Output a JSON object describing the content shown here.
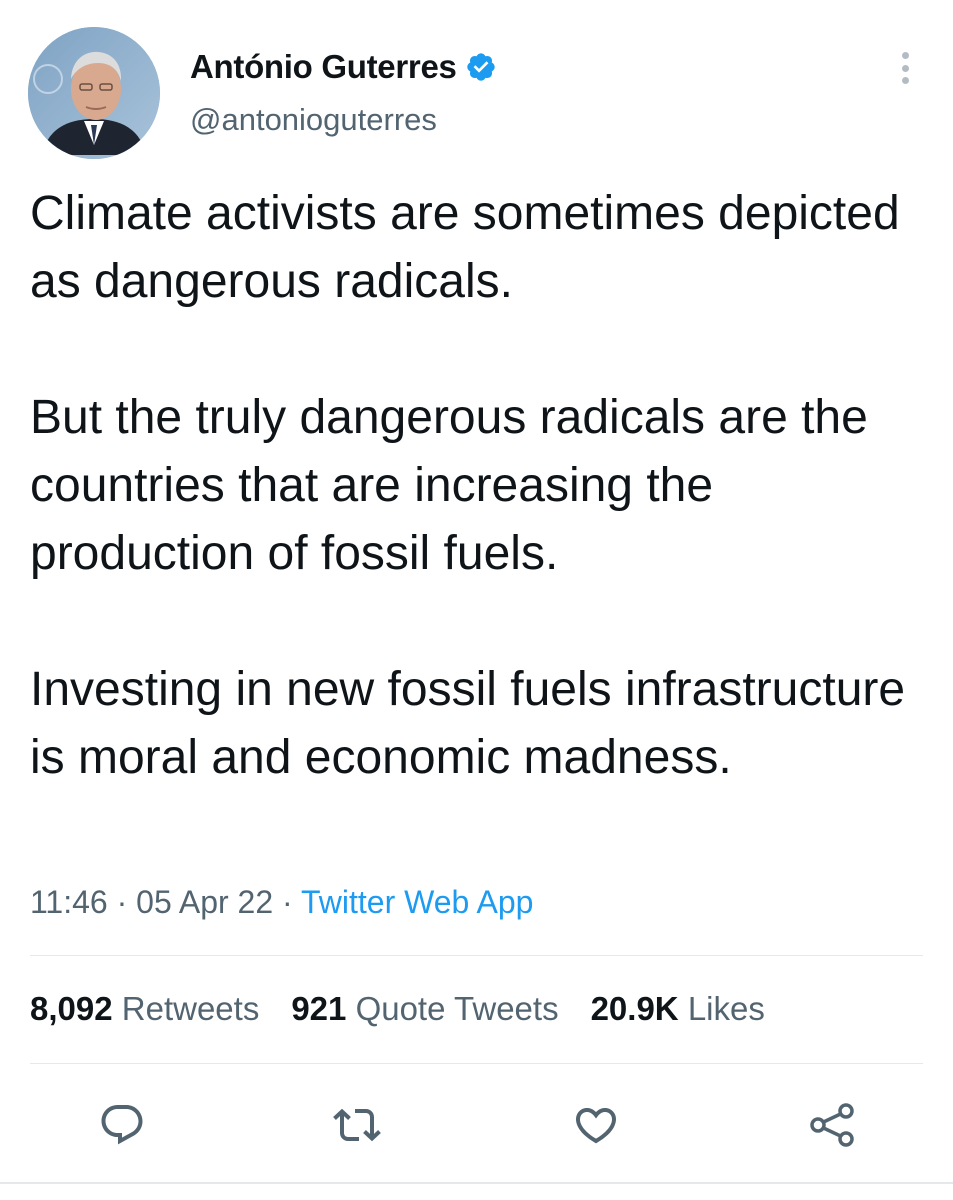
{
  "author": {
    "display_name": "António Guterres",
    "handle": "@antonioguterres",
    "verified_icon": "verified-badge-icon",
    "avatar_icon": "profile-photo"
  },
  "more_icon": "more-vertical-icon",
  "tweet": {
    "paragraphs": [
      "Climate activists are sometimes depicted as dangerous radicals.",
      "But the truly dangerous radicals are the countries that are increasing the production of fossil fuels.",
      "Investing in new fossil fuels infrastructure is moral and economic madness."
    ],
    "time": "11:46",
    "date": "05 Apr 22",
    "separator": "·",
    "source": "Twitter Web App"
  },
  "stats": {
    "retweets_count": "8,092",
    "retweets_label": "Retweets",
    "quotes_count": "921",
    "quotes_label": "Quote Tweets",
    "likes_count": "20.9K",
    "likes_label": "Likes"
  },
  "actions": {
    "reply_icon": "reply-icon",
    "retweet_icon": "retweet-icon",
    "like_icon": "like-icon",
    "share_icon": "share-icon"
  },
  "colors": {
    "text": "#0f1419",
    "secondary": "#536471",
    "accent": "#1d9bf0",
    "divider": "#e6e9eb"
  }
}
